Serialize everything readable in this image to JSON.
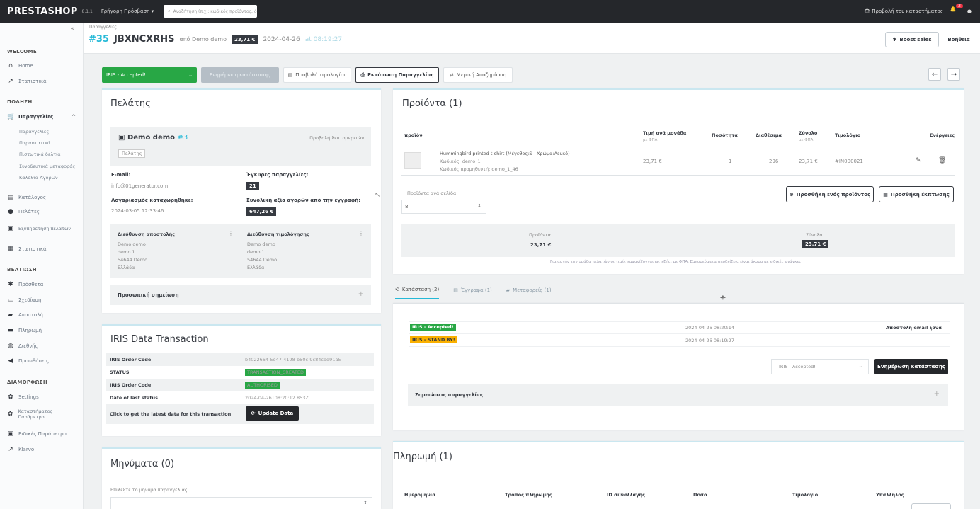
{
  "topbar": {
    "logo": "PRESTASHOP",
    "version": "8.1.1",
    "quick_access": "Γρήγορη Πρόσβαση ▾",
    "search_placeholder": "Αναζήτηση (π.χ.: κωδικός προϊόντος, ό",
    "view_store": "Προβολή του καταστήματος",
    "notif_count": "2"
  },
  "sidebar": {
    "collapse": "«",
    "welcome": "WELCOME",
    "home": "Home",
    "stats": "Στατιστικά",
    "sales_section": "ΠΩΛΗΣΗ",
    "orders": "Παραγγελίες",
    "orders_sub": [
      "Παραγγελίες",
      "Παραστατικά",
      "Πιστωτικά δελτία",
      "Συνοδευτικά μεταφοράς",
      "Καλάθια Αγορών"
    ],
    "catalog": "Κατάλογος",
    "customers": "Πελάτες",
    "service": "Εξυπηρέτηση πελατών",
    "statistics": "Στατιστικά",
    "improve_section": "ΒΕΛΤΙΩΣΗ",
    "modules": "Πρόσθετα",
    "design": "Σχεδίαση",
    "shipping": "Αποστολή",
    "payment": "Πληρωμή",
    "international": "Διεθνής",
    "promotions": "Προωθήσεις",
    "config_section": "ΔΙΑΜΟΡΦΩΣΗ",
    "settings": "Settings",
    "shop_params": "Καταστήματος Παράμετροι",
    "advanced": "Ειδικές Παράμετροι",
    "klarna": "Klarvo"
  },
  "header": {
    "breadcrumb": "Παραγγελίες",
    "order_num": "#35",
    "order_ref": "JBXNCXRHS",
    "from": "από Demo demo",
    "total": "23,71 €",
    "date": "2024-04-26",
    "time": "at 08:19:27",
    "boost": "Boost sales",
    "help": "Βοήθεια"
  },
  "actions": {
    "status": "IRIS - Accepted!",
    "update_status": "Ενημέρωση κατάστασης",
    "view_invoice": "Προβολή τιμολογίου",
    "print_order": "Εκτύπωση Παραγγελίας",
    "partial_refund": "Μερική Αποζημίωση"
  },
  "customer": {
    "title": "Πελάτης",
    "name": "Demo demo",
    "id": "#3",
    "view_details": "Προβολή λεπτομερειών",
    "group": "Πελάτης",
    "email_label": "E-mail:",
    "email": "info@01generator.com",
    "valid_orders_label": "Έγκυρες παραγγελίες:",
    "valid_orders": "21",
    "account_label": "Λογαριασμός καταχωρήθηκε:",
    "account_date": "2024-03-05 12:33:46",
    "total_spent_label": "Συνολική αξία αγορών από την εγγραφή:",
    "total_spent": "647,26 €",
    "ship_label": "Διεύθυνση αποστολής",
    "bill_label": "Διεύθυνση τιμολόγησης",
    "ship_addr": [
      "Demo demo",
      "demo 1",
      "54644 Demo",
      "Ελλάδα"
    ],
    "bill_addr": [
      "Demo demo",
      "demo 1",
      "54644 Demo",
      "Ελλάδα"
    ],
    "note_label": "Προσωπική σημείωση"
  },
  "iris": {
    "title": "IRIS Data Transaction",
    "rows": [
      {
        "k": "IRIS Order Code",
        "v": "b4022664-5e47-4198-b50c-9c84cbd91a5"
      },
      {
        "k": "STATUS",
        "v": "TRANSACTION_CREATED"
      },
      {
        "k": "IRIS Order Code",
        "v": "AUTHORISED"
      },
      {
        "k": "Date of last status",
        "v": "2024-04-26T08:20:12.853Z"
      }
    ],
    "get_latest": "Click to get the latest data for this transaction",
    "update_btn": "Update Data"
  },
  "messages": {
    "title": "Μηνύματα (0)",
    "choose": "Επιλέξτε το μήνυμα παραγγελίας"
  },
  "products": {
    "title": "Προϊόντα (1)",
    "headers": {
      "product": "προϊόν",
      "unit_price": "Τιμή ανά μονάδα",
      "unit_note": "με ΦΠΑ",
      "qty": "Ποσότητα",
      "available": "Διαθέσιμα",
      "total": "Σύνολο",
      "total_note": "με ΦΠΑ",
      "invoice": "Τιμολόγιο",
      "actions": "Ενέργειες"
    },
    "item": {
      "name": "Hummingbird printed t-shirt (Μέγεθος:S - Χρώμα:Λευκό)",
      "code": "Κωδικός: demo_1",
      "supplier_code": "Κωδικός προμηθευτή: demo_1_46",
      "unit": "23,71 €",
      "qty": "1",
      "avail": "296",
      "total": "23,71 €",
      "invoice": "#IN000021"
    },
    "per_page_label": "Προϊόντα ανά σελίδα:",
    "per_page": "8",
    "add_product": "Προσθήκη ενός προϊόντος",
    "add_discount": "Προσθήκη έκπτωσης",
    "sum_products_label": "Προϊόντα",
    "sum_products": "23,71 €",
    "sum_total_label": "Σύνολο",
    "sum_total": "23,71 €",
    "note": "Για αυτήν την ομάδα πελατών οι τιμές εμφανίζονται ως εξής: με ΦΠΑ. Εμπορεύματα αποδείξεις είναι άκυρα με ειδικές ανάγκες"
  },
  "history": {
    "tabs": [
      "Κατάσταση (2)",
      "Έγγραφα (1)",
      "Μεταφορείς (1)"
    ],
    "rows": [
      {
        "status": "IRIS - Accepted!",
        "date": "2024-04-26 08:20:14",
        "extra": "Αποστολή email ξανά"
      },
      {
        "status": "IRIS - STAND BY!",
        "date": "2024-04-26 08:19:27",
        "extra": ""
      }
    ],
    "select": "IRIS - Accepted!",
    "update_btn": "Ενημέρωση κατάστασης",
    "notes_label": "Σημειώσεις παραγγελίας"
  },
  "payment": {
    "title": "Πληρωμή (1)",
    "headers": [
      "Ημερομηνία",
      "Τρόπος πληρωμής",
      "ID συναλλαγής",
      "Ποσό",
      "Τιμολόγιο",
      "Υπάλληλος"
    ]
  },
  "colors": {
    "accent": "#25b9d7",
    "green": "#28a745",
    "dark": "#363a41",
    "standby": "#fab000"
  }
}
